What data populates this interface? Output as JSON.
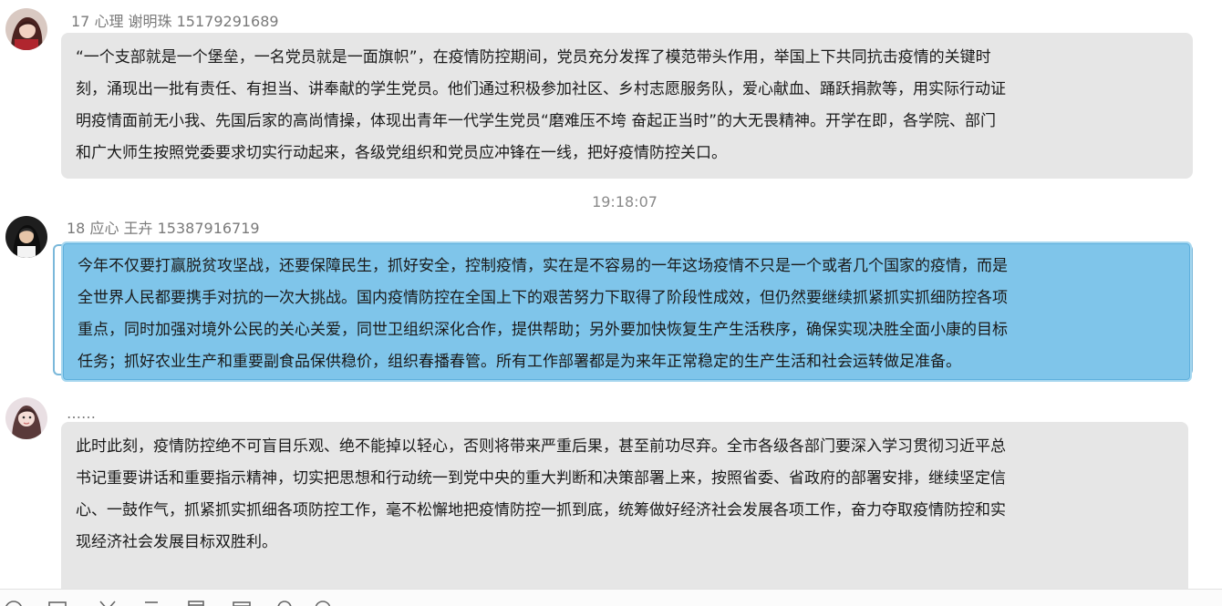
{
  "messages": [
    {
      "sender": "17  心理  谢明珠  15179291689",
      "lines": [
        "“一个支部就是一个堡垒，一名党员就是一面旗帜”，在疫情防控期间，党员充分发挥了模范带头作用，举国上下共同抗击疫情的关键时",
        "刻，涌现出一批有责任、有担当、讲奉献的学生党员。他们通过积极参加社区、乡村志愿服务队，爱心献血、踊跃捐款等，用实际行动证",
        "明疫情面前无小我、先国后家的高尚情操，体现出青年一代学生党员“磨难压不垮 奋起正当时”的大无畏精神。开学在即，各学院、部门",
        "和广大师生按照党委要求切实行动起来，各级党组织和党员应冲锋在一线，把好疫情防控关口。"
      ]
    },
    {
      "sender": "18 应心 王卉 15387916719",
      "lines": [
        "今年不仅要打赢脱贫攻坚战，还要保障民生，抓好安全，控制疫情，实在是不容易的一年这场疫情不只是一个或者几个国家的疫情，而是",
        "全世界人民都要携手对抗的一次大挑战。国内疫情防控在全国上下的艰苦努力下取得了阶段性成效，但仍然要继续抓紧抓实抓细防控各项",
        "重点，同时加强对境外公民的关心关爱，同世卫组织深化合作，提供帮助；另外要加快恢复生产生活秩序，确保实现决胜全面小康的目标",
        "任务；抓好农业生产和重要副食品保供稳价，组织春播春管。所有工作部署都是为来年正常稳定的生产生活和社会运转做足准备。"
      ]
    },
    {
      "sender": "……",
      "lines": [
        "此时此刻，疫情防控绝不可盲目乐观、绝不能掉以轻心，否则将带来严重后果，甚至前功尽弃。全市各级各部门要深入学习贯彻习近平总",
        "书记重要讲话和重要指示精神，切实把思想和行动统一到党中央的重大判断和决策部署上来，按照省委、省政府的部署安排，继续坚定信",
        "心、一鼓作气，抓紧抓实抓细各项防控工作，毫不松懈地把疫情防控一抓到底，统筹做好经济社会发展各项工作，奋力夺取疫情防控和实",
        "现经济社会发展目标双胜利。"
      ]
    }
  ],
  "timestamp": "19:18:07",
  "colors": {
    "bubble_bg": "#e6e6e6",
    "selected_bg": "#7fc5ea",
    "meta_text": "#7a7a7a"
  },
  "toolbar_icons": [
    "emoji-icon",
    "image-icon",
    "scissors-icon",
    "shake-icon",
    "document-icon",
    "folder-icon",
    "microphone-icon",
    "search-icon"
  ]
}
